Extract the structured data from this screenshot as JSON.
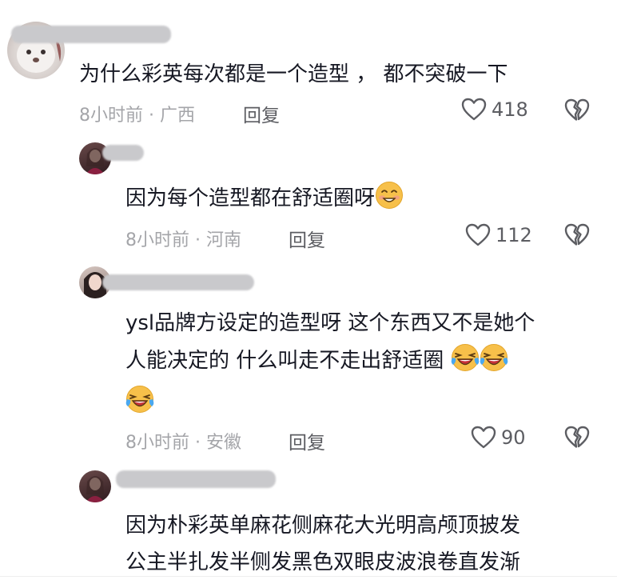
{
  "comments": [
    {
      "text": "为什么彩英每次都是一个造型 ， 都不突破一下",
      "time": "8小时前",
      "location": "· 广西",
      "reply": "回复",
      "likes": "418"
    },
    {
      "text": "因为每个造型都在舒适圈呀",
      "time": "8小时前",
      "location": "· 河南",
      "reply": "回复",
      "likes": "112"
    },
    {
      "line1": "ysl品牌方设定的造型呀 这个东西又不是她个",
      "line2": "人能决定的 什么叫走不走出舒适圈",
      "time": "8小时前",
      "location": "· 安徽",
      "reply": "回复",
      "likes": "90"
    },
    {
      "line1": "因为朴彩英单麻花侧麻花大光明高颅顶披发",
      "line2": "公主半扎发半侧发黑色双眼皮波浪卷直发渐"
    }
  ],
  "icons": {
    "like": "heart-outline-icon",
    "dislike": "broken-heart-icon",
    "emoji_smile": "blushing-smile-emoji",
    "emoji_laugh": "laughing-crying-emoji"
  },
  "colors": {
    "text": "#161823",
    "meta": "#a4a5a9",
    "action": "#5c5d62"
  }
}
